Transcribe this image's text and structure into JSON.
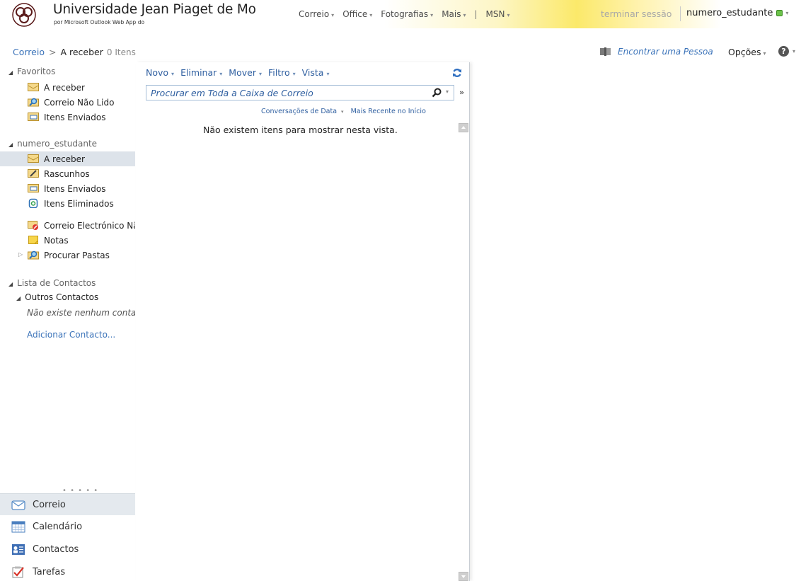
{
  "header": {
    "org_title": "Universidade Jean Piaget de Mo",
    "org_subtitle": "por Microsoft Outlook Web App do",
    "nav": [
      {
        "label": "Correio",
        "caret": "▾"
      },
      {
        "label": "Office",
        "caret": "▾"
      },
      {
        "label": "Fotografias",
        "caret": "▾"
      },
      {
        "label": "Mais",
        "caret": "▾"
      },
      {
        "label": "MSN",
        "caret": "▾"
      }
    ],
    "nav_separator": "|",
    "logout": "terminar sessão",
    "username": "numero_estudante",
    "presence_color": "#6cc24a"
  },
  "breadcrumb": {
    "root": "Correio",
    "arrow": ">",
    "current": "A receber",
    "count": "0 Itens"
  },
  "top_actions": {
    "find_person": "Encontrar uma Pessoa",
    "options": "Opções",
    "help": "?"
  },
  "leftnav": {
    "favorites": {
      "title": "Favoritos",
      "items": [
        {
          "label": "A receber",
          "icon": "inbox-icon"
        },
        {
          "label": "Correio Não Lido",
          "icon": "search-folder-icon"
        },
        {
          "label": "Itens Enviados",
          "icon": "sent-items-icon"
        }
      ]
    },
    "mailbox": {
      "title": "numero_estudante",
      "items": [
        {
          "label": "A receber",
          "icon": "inbox-icon"
        },
        {
          "label": "Rascunhos",
          "icon": "drafts-icon"
        },
        {
          "label": "Itens Enviados",
          "icon": "sent-items-icon"
        },
        {
          "label": "Itens Eliminados",
          "icon": "deleted-items-icon"
        },
        {
          "label": "Correio Electrónico Não",
          "icon": "junk-mail-icon"
        },
        {
          "label": "Notas",
          "icon": "notes-icon"
        },
        {
          "label": "Procurar Pastas",
          "icon": "search-folder-icon"
        }
      ]
    },
    "contacts": {
      "title": "Lista de Contactos",
      "group": "Outros Contactos",
      "empty": "Não existe nenhum contacto",
      "add": "Adicionar Contacto..."
    },
    "grip": "• • • • •",
    "modules": [
      {
        "label": "Correio",
        "icon": "mail-icon"
      },
      {
        "label": "Calendário",
        "icon": "calendar-icon"
      },
      {
        "label": "Contactos",
        "icon": "contacts-icon"
      },
      {
        "label": "Tarefas",
        "icon": "tasks-icon"
      }
    ]
  },
  "toolbar": {
    "new": "Novo",
    "delete": "Eliminar",
    "move": "Mover",
    "filter": "Filtro",
    "view": "Vista",
    "caret": "▾"
  },
  "search": {
    "placeholder": "Procurar em Toda a Caixa de Correio"
  },
  "sort": {
    "arrange_by": "Conversações de Data",
    "order": "Mais Recente no Início"
  },
  "list": {
    "empty_message": "Não existem itens para mostrar nesta vista."
  },
  "colors": {
    "link": "#3b73b9",
    "toolbar_text": "#2f5fa0",
    "selected_row": "#dde3ea",
    "header_accent": "#fbe96a"
  }
}
